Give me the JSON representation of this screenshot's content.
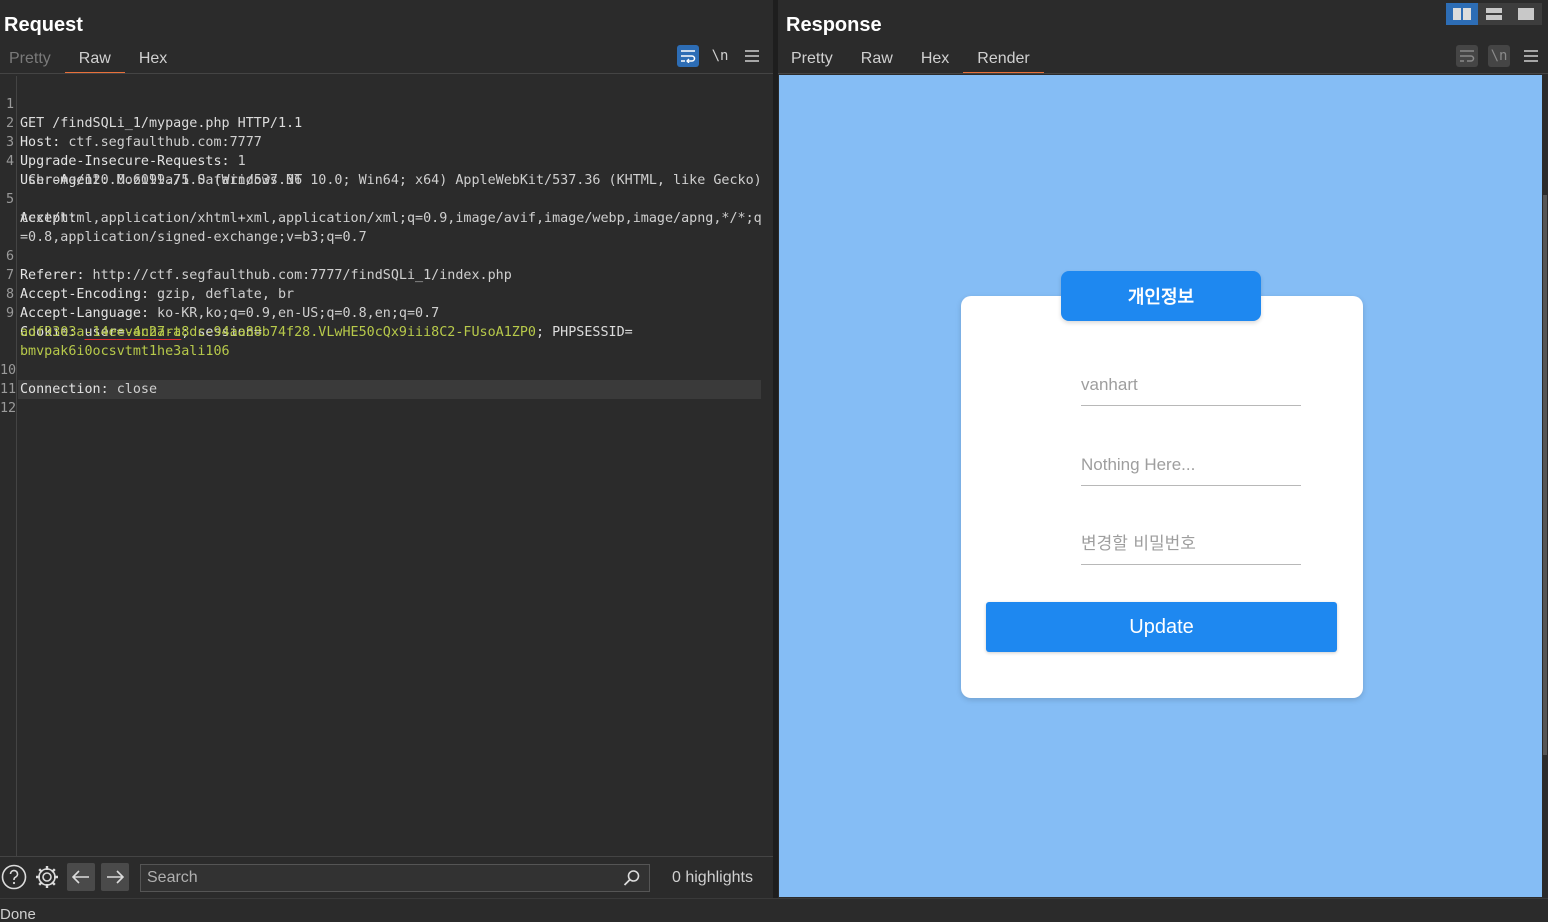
{
  "request": {
    "title": "Request",
    "tabs": [
      "Pretty",
      "Raw",
      "Hex"
    ],
    "tools": {
      "wrap": "wrap-lines",
      "newline": "\\n",
      "menu": "menu"
    },
    "lines": {
      "l1": {
        "num": "1",
        "text": "GET /findSQLi_1/mypage.php HTTP/1.1"
      },
      "l2": {
        "num": "2",
        "name": "Host",
        "value": " ctf.segfaulthub.com:7777"
      },
      "l3": {
        "num": "3",
        "name": "Upgrade-Insecure-Requests",
        "value": " 1"
      },
      "l4": {
        "num": "4",
        "name": "User-Agent",
        "value": " Mozilla/5.0 (Windows NT 10.0; Win64; x64) AppleWebKit/537.36 (KHTML, like Gecko)",
        "cont": " Chrome/120.0.6099.71 Safari/537.36"
      },
      "l5": {
        "num": "5",
        "name": "Accept",
        "value": "",
        "cont1": "text/html,application/xhtml+xml,application/xml;q=0.9,image/avif,image/webp,image/apng,*/*;q",
        "cont2": "=0.8,application/signed-exchange;v=b3;q=0.7"
      },
      "l6": {
        "num": "6",
        "name": "Referer",
        "value": " http://ctf.segfaulthub.com:7777/findSQLi_1/index.php"
      },
      "l7": {
        "num": "7",
        "name": "Accept-Encoding",
        "value": " gzip, deflate, br"
      },
      "l8": {
        "num": "8",
        "name": "Accept-Language",
        "value": " ko-KR,ko;q=0.9,en-US;q=0.8,en;q=0.7"
      },
      "l9": {
        "num": "9",
        "name": "Cookie",
        "c1_name": "user",
        "c1_value": "vanhart",
        "c2_name": "session",
        "c2_value": "adf9303a-14ee-4c27-a8dc-94aa88b74f28.VLwHE50cQx9iii8C2-FUsoA1ZP0",
        "c3_name": "PHPSESSID",
        "c3_value": "bmvpak6i0ocsvtmt1he3ali106"
      },
      "l10": {
        "num": "10",
        "name": "Connection",
        "value": " close"
      },
      "l11": {
        "num": "11"
      },
      "l12": {
        "num": "12"
      }
    },
    "search_placeholder": "Search",
    "highlights": "0 highlights"
  },
  "response": {
    "title": "Response",
    "tabs": [
      "Pretty",
      "Raw",
      "Hex",
      "Render"
    ],
    "render": {
      "badge": "개인정보",
      "field_user": "vanhart",
      "field_info": "Nothing Here...",
      "field_password": "변경할 비밀번호",
      "button": "Update"
    }
  },
  "status": "Done",
  "colors": {
    "accent_tab": "#e8703a",
    "toggle_on": "#2d6db5",
    "render_bg": "#85bdf5",
    "button": "#1e88f0",
    "cookie_value": "#b7c94a"
  }
}
